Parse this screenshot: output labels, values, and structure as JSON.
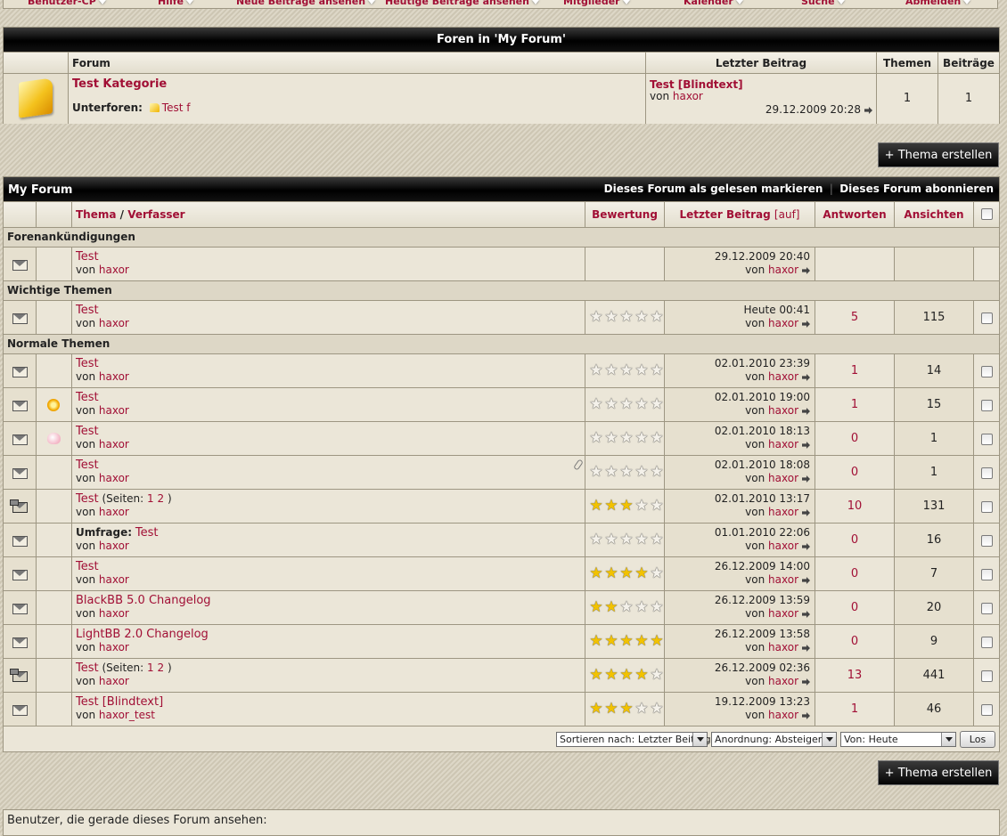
{
  "navbar": {
    "items": [
      "Benutzer-CP",
      "Hilfe",
      "Neue Beiträge ansehen",
      "Heutige Beiträge ansehen",
      "Mitglieder",
      "Kalender",
      "Suche",
      "Abmelden"
    ]
  },
  "forums": {
    "title": "Foren in 'My Forum'",
    "headers": {
      "forum": "Forum",
      "last_post": "Letzter Beitrag",
      "threads": "Themen",
      "posts": "Beiträge"
    },
    "row": {
      "name": "Test Kategorie",
      "subforums_label": "Unterforen:",
      "subforum": "Test f",
      "last_title": "Test [Blindtext]",
      "by_prefix": "von",
      "last_user": "haxor",
      "last_date": "29.12.2009 20:28",
      "threads": "1",
      "posts": "1"
    }
  },
  "create_thread_label": "+ Thema erstellen",
  "thread_list": {
    "title": "My Forum",
    "mark_read": "Dieses Forum als gelesen markieren",
    "subscribe": "Dieses Forum abonnieren",
    "headers": {
      "thema": "Thema",
      "slash": "/",
      "verfasser": "Verfasser",
      "rating": "Bewertung",
      "last_post": "Letzter Beitrag",
      "sort_dir": "[auf]",
      "replies": "Antworten",
      "views": "Ansichten"
    },
    "sections": {
      "announcements": "Forenankündigungen",
      "sticky": "Wichtige Themen",
      "normal": "Normale Themen"
    },
    "by_prefix": "von",
    "announcement": {
      "title": "Test",
      "author": "haxor",
      "date": "29.12.2009 20:40",
      "last_user": "haxor"
    },
    "sticky": [
      {
        "title": "Test",
        "author": "haxor",
        "stars": 0,
        "date": "Heute 00:41",
        "last_user": "haxor",
        "replies": "5",
        "views": "115"
      }
    ],
    "pages_label": "(Seiten:",
    "pages_close": ")",
    "poll_label": "Umfrage:",
    "threads": [
      {
        "title": "Test",
        "author": "haxor",
        "stars": 0,
        "date": "02.01.2010 23:39",
        "last_user": "haxor",
        "replies": "1",
        "views": "14"
      },
      {
        "title": "Test",
        "author": "haxor",
        "stars": 0,
        "date": "02.01.2010 19:00",
        "last_user": "haxor",
        "replies": "1",
        "views": "15",
        "post_icon": "sun-icon"
      },
      {
        "title": "Test",
        "author": "haxor",
        "stars": 0,
        "date": "02.01.2010 18:13",
        "last_user": "haxor",
        "replies": "0",
        "views": "1",
        "post_icon": "rose-icon"
      },
      {
        "title": "Test",
        "author": "haxor",
        "stars": 0,
        "date": "02.01.2010 18:08",
        "last_user": "haxor",
        "replies": "0",
        "views": "1",
        "attachment": true
      },
      {
        "title": "Test",
        "author": "haxor",
        "stars": 3,
        "date": "02.01.2010 13:17",
        "last_user": "haxor",
        "replies": "10",
        "views": "131",
        "pages": [
          "1",
          "2"
        ],
        "hot": true
      },
      {
        "title": "Test",
        "author": "haxor",
        "stars": 0,
        "date": "01.01.2010 22:06",
        "last_user": "haxor",
        "replies": "0",
        "views": "16",
        "poll": true
      },
      {
        "title": "Test",
        "author": "haxor",
        "stars": 4,
        "date": "26.12.2009 14:00",
        "last_user": "haxor",
        "replies": "0",
        "views": "7"
      },
      {
        "title": "BlackBB 5.0 Changelog",
        "author": "haxor",
        "stars": 2,
        "date": "26.12.2009 13:59",
        "last_user": "haxor",
        "replies": "0",
        "views": "20"
      },
      {
        "title": "LightBB 2.0 Changelog",
        "author": "haxor",
        "stars": 5,
        "date": "26.12.2009 13:58",
        "last_user": "haxor",
        "replies": "0",
        "views": "9"
      },
      {
        "title": "Test",
        "author": "haxor",
        "stars": 4,
        "date": "26.12.2009 02:36",
        "last_user": "haxor",
        "replies": "13",
        "views": "441",
        "pages": [
          "1",
          "2"
        ],
        "hot": true
      },
      {
        "title": "Test [Blindtext]",
        "author": "haxor_test",
        "stars": 3,
        "date": "19.12.2009 13:23",
        "last_user": "haxor",
        "replies": "1",
        "views": "46"
      }
    ],
    "sort_select": "Sortieren nach: Letzter Beitrag",
    "order_select": "Anordnung: Absteigend",
    "from_select": "Von: Heute",
    "go_button": "Los"
  },
  "viewers_text": "Benutzer, die gerade dieses Forum ansehen:"
}
